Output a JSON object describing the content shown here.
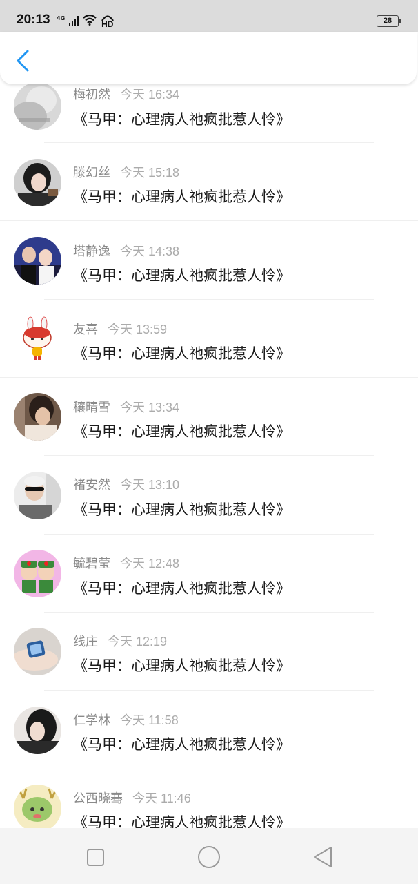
{
  "status_bar": {
    "time": "20:13",
    "network": "4G",
    "hd_label": "HD",
    "battery": "28",
    "icons": [
      "signal-icon",
      "wifi-icon",
      "hd-call-icon",
      "battery-icon"
    ]
  },
  "header": {
    "back_icon": "chevron-left-icon",
    "accent_color": "#2196f3"
  },
  "messages": [
    {
      "name": "梅初然",
      "time": "今天 16:34",
      "text": "《马甲：心理病人祂疯批惹人怜》"
    },
    {
      "name": "滕幻丝",
      "time": "今天 15:18",
      "text": "《马甲：心理病人祂疯批惹人怜》"
    },
    {
      "name": "塔静逸",
      "time": "今天 14:38",
      "text": "《马甲：心理病人祂疯批惹人怜》"
    },
    {
      "name": "友喜",
      "time": "今天 13:59",
      "text": "《马甲：心理病人祂疯批惹人怜》"
    },
    {
      "name": "穰晴雪",
      "time": "今天 13:34",
      "text": "《马甲：心理病人祂疯批惹人怜》"
    },
    {
      "name": "褚安然",
      "time": "今天 13:10",
      "text": "《马甲：心理病人祂疯批惹人怜》"
    },
    {
      "name": "毓碧莹",
      "time": "今天 12:48",
      "text": "《马甲：心理病人祂疯批惹人怜》"
    },
    {
      "name": "线庄",
      "time": "今天 12:19",
      "text": "《马甲：心理病人祂疯批惹人怜》"
    },
    {
      "name": "仁学林",
      "time": "今天 11:58",
      "text": "《马甲：心理病人祂疯批惹人怜》"
    },
    {
      "name": "公西晓骞",
      "time": "今天 11:46",
      "text": "《马甲：心理病人祂疯批惹人怜》"
    }
  ],
  "nav_bar": {
    "recents_icon": "square-recents-icon",
    "home_icon": "circle-home-icon",
    "back_icon": "triangle-back-icon"
  }
}
